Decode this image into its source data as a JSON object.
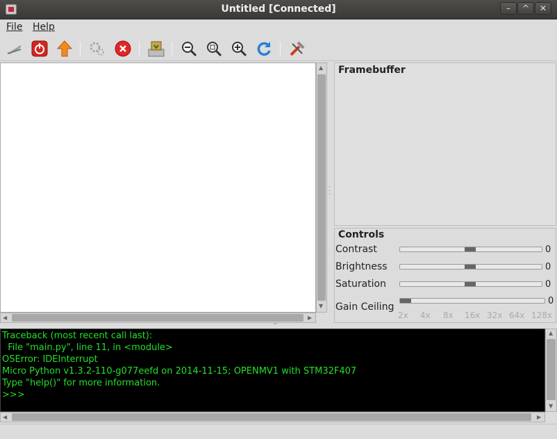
{
  "window": {
    "title": "Untitled [Connected]",
    "controls": {
      "minimize": "–",
      "maximize": "^",
      "close": "✕"
    }
  },
  "menu": {
    "file": "File",
    "help": "Help"
  },
  "toolbar": {
    "buttons": [
      "connect-icon",
      "disconnect-icon",
      "upload-icon",
      "settings-icon",
      "stop-icon",
      "save-image-icon",
      "zoom-out-icon",
      "zoom-fit-icon",
      "zoom-in-icon",
      "reset-icon",
      "tools-icon"
    ]
  },
  "framebuffer": {
    "title": "Framebuffer"
  },
  "controls": {
    "title": "Controls",
    "contrast": {
      "label": "Contrast",
      "value": "0"
    },
    "brightness": {
      "label": "Brightness",
      "value": "0"
    },
    "saturation": {
      "label": "Saturation",
      "value": "0"
    },
    "gain_ceiling": {
      "label": "Gain Ceiling",
      "value": "0"
    },
    "gain_ticks": [
      "2x",
      "4x",
      "8x",
      "16x",
      "32x",
      "64x",
      "128x"
    ]
  },
  "console": {
    "lines": [
      "Traceback (most recent call last):",
      "  File \"main.py\", line 11, in <module>",
      "OSError: IDEInterrupt",
      "Micro Python v1.3.2-110-g077eefd on 2014-11-15; OPENMV1 with STM32F407",
      "Type \"help()\" for more information.",
      ">>>"
    ]
  }
}
